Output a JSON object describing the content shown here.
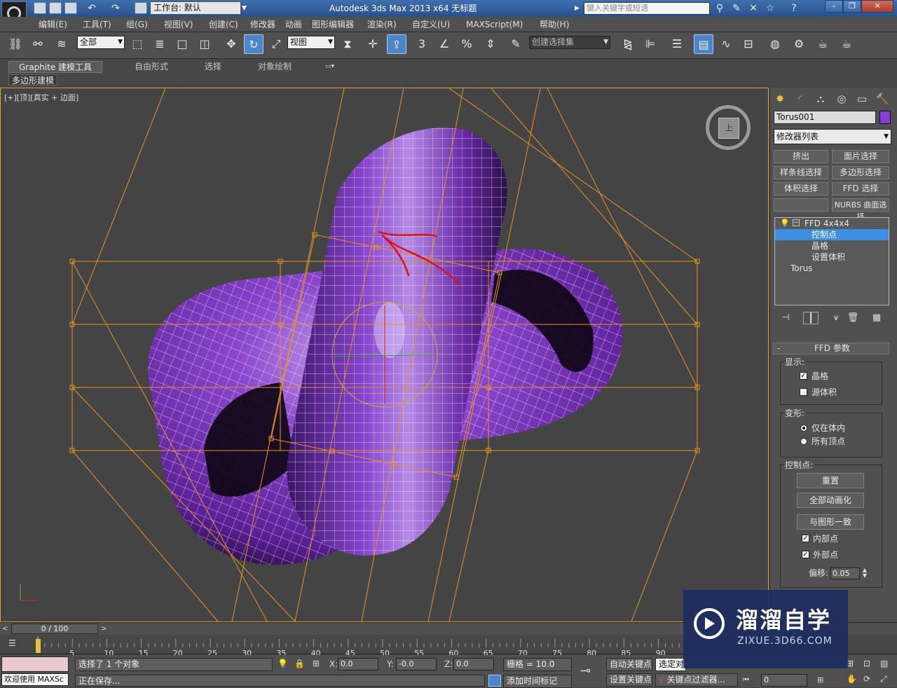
{
  "titlebar": {
    "workspace_label": "工作台: 默认",
    "app_title": "Autodesk 3ds Max  2013 x64     无标题",
    "search_placeholder": "键入关键字或短语"
  },
  "menubar": {
    "items": [
      "编辑(E)",
      "工具(T)",
      "组(G)",
      "视图(V)",
      "创建(C)",
      "修改器",
      "动画",
      "图形编辑器",
      "渲染(R)",
      "自定义(U)",
      "MAXScript(M)",
      "帮助(H)"
    ]
  },
  "toolbar": {
    "selection_filter": "全部",
    "ref_coord": "视图",
    "named_selection": "创建选择集",
    "snap_label": "3"
  },
  "ribbon": {
    "tabs": [
      "Graphite 建模工具",
      "自由形式",
      "选择",
      "对象绘制"
    ],
    "active_panel": "多边形建模"
  },
  "viewport": {
    "label": "[+][顶][真实 + 边面]",
    "viewcube_face": "上",
    "object_color": "#8d3bd8",
    "lattice_color": "#e8941e",
    "annotation_color": "#e01010"
  },
  "command_panel": {
    "object_name": "Torus001",
    "modifier_list": "修改器列表",
    "buttons": [
      "挤出",
      "面片选择",
      "样条线选择",
      "多边形选择",
      "体积选择",
      "FFD 选择",
      "",
      "NURBS 曲面选择"
    ],
    "stack": [
      {
        "label": "FFD 4x4x4",
        "selected": false
      },
      {
        "label": "控制点",
        "selected": true
      },
      {
        "label": "晶格",
        "selected": false
      },
      {
        "label": "设置体积",
        "selected": false
      },
      {
        "label": "Torus",
        "selected": false
      }
    ],
    "rollout_title": "FFD 参数",
    "display_group": "显示:",
    "lattice_label": "晶格",
    "lattice_checked": true,
    "source_volume_label": "源体积",
    "source_volume_checked": false,
    "deform_group": "变形:",
    "inside_only_label": "仅在体内",
    "all_vertices_label": "所有顶点",
    "deform_mode": "仅在体内",
    "control_points_group": "控制点:",
    "reset_label": "重置",
    "animate_all_label": "全部动画化",
    "conform_label": "与图形一致",
    "inside_points_label": "内部点",
    "inside_points_checked": true,
    "outside_points_label": "外部点",
    "outside_points_checked": true,
    "offset_label": "偏移:",
    "offset_value": "0.05"
  },
  "timeline": {
    "frame_display": "0 / 100",
    "ticks": [
      "0",
      "5",
      "10",
      "15",
      "20",
      "25",
      "30",
      "35",
      "40",
      "45",
      "50",
      "55",
      "60",
      "65",
      "70",
      "75",
      "80",
      "85",
      "90"
    ]
  },
  "statusbar": {
    "welcome": "欢迎使用 MAXSc",
    "selection_info": "选择了 1 个对象",
    "saving_info": "正在保存...",
    "x_label": "X:",
    "x_value": "0.0",
    "y_label": "Y:",
    "y_value": "-0.0",
    "z_label": "Z:",
    "z_value": "0.0",
    "grid_info": "栅格 = 10.0",
    "auto_key": "自动关键点",
    "selected_mode": "选定对",
    "set_key": "设置关键点",
    "key_filter": "关键点过滤器...",
    "add_time_tag": "添加时间标记",
    "frame_value": "0"
  },
  "watermark": {
    "title": "溜溜自学",
    "subtitle": "ZIXUE.3D66.COM"
  }
}
